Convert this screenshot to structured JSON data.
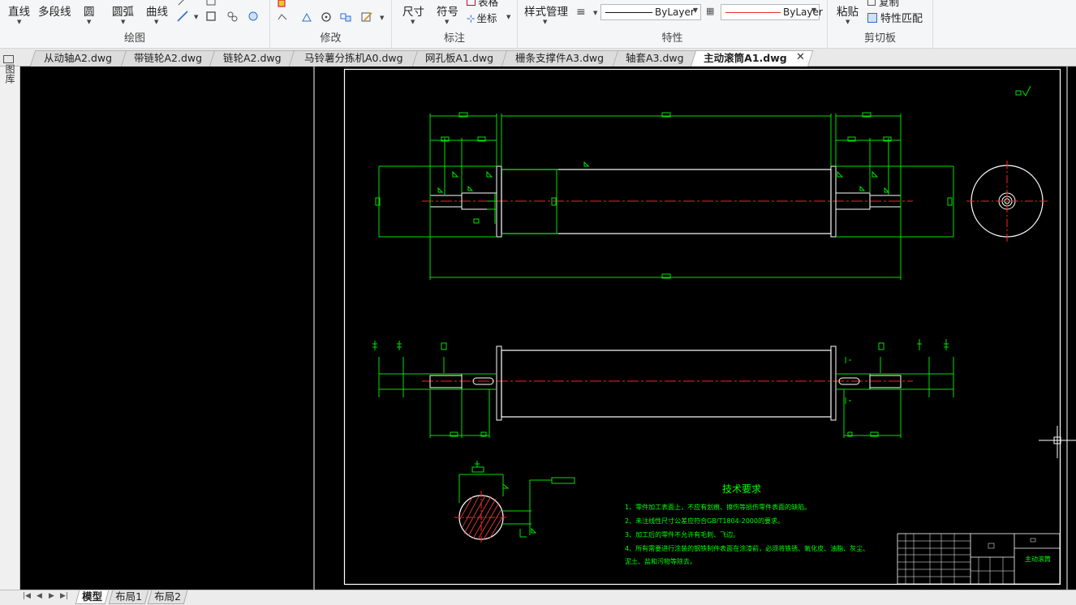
{
  "ribbon": {
    "draw_tools": [
      "直线",
      "多段线",
      "圆",
      "圆弧",
      "曲线"
    ],
    "draw_label": "绘图",
    "modify_label": "修改",
    "annot_tools": [
      "尺寸",
      "符号"
    ],
    "annot_small": [
      "表格",
      "坐标"
    ],
    "annot_label": "标注",
    "style_manage": "样式管理",
    "layer_linetype": "ByLayer",
    "layer_color": "ByLayer",
    "props_label": "特性",
    "paste": "粘贴",
    "copy": "复制",
    "match_props": "特性匹配",
    "clipboard_label": "剪切板",
    "accent_red": "#e03030"
  },
  "tabs": [
    {
      "label": "从动轴A2.dwg",
      "active": false
    },
    {
      "label": "带链轮A2.dwg",
      "active": false
    },
    {
      "label": "链轮A2.dwg",
      "active": false
    },
    {
      "label": "马铃薯分拣机A0.dwg",
      "active": false
    },
    {
      "label": "网孔板A1.dwg",
      "active": false
    },
    {
      "label": "栅条支撑件A3.dwg",
      "active": false
    },
    {
      "label": "轴套A3.dwg",
      "active": false
    },
    {
      "label": "主动滚筒A1.dwg",
      "active": true
    }
  ],
  "left_strip": {
    "label": "图库"
  },
  "drawing": {
    "tech_title": "技术要求",
    "tech_notes": [
      "1、零件加工表面上，不应有划痕、擦伤等损伤零件表面的缺陷。",
      "2、未注线性尺寸公差应符合GB/T1804-2000的要求。",
      "3、加工后的零件不允许有毛刺、飞边。",
      "4、所有需要进行涂装的钢铁制件表面在涂漆前，必须将铁锈、氧化皮、油脂、灰尘、",
      "泥土、盐和污物等除去。"
    ],
    "title_block_name": "主动滚筒",
    "colors": {
      "outline": "#ffffff",
      "dim": "#00e000",
      "center": "#ff2020",
      "text": "#00ff00"
    }
  },
  "bottom": {
    "layouts": [
      {
        "label": "模型",
        "active": true
      },
      {
        "label": "布局1",
        "active": false
      },
      {
        "label": "布局2",
        "active": false
      }
    ]
  }
}
